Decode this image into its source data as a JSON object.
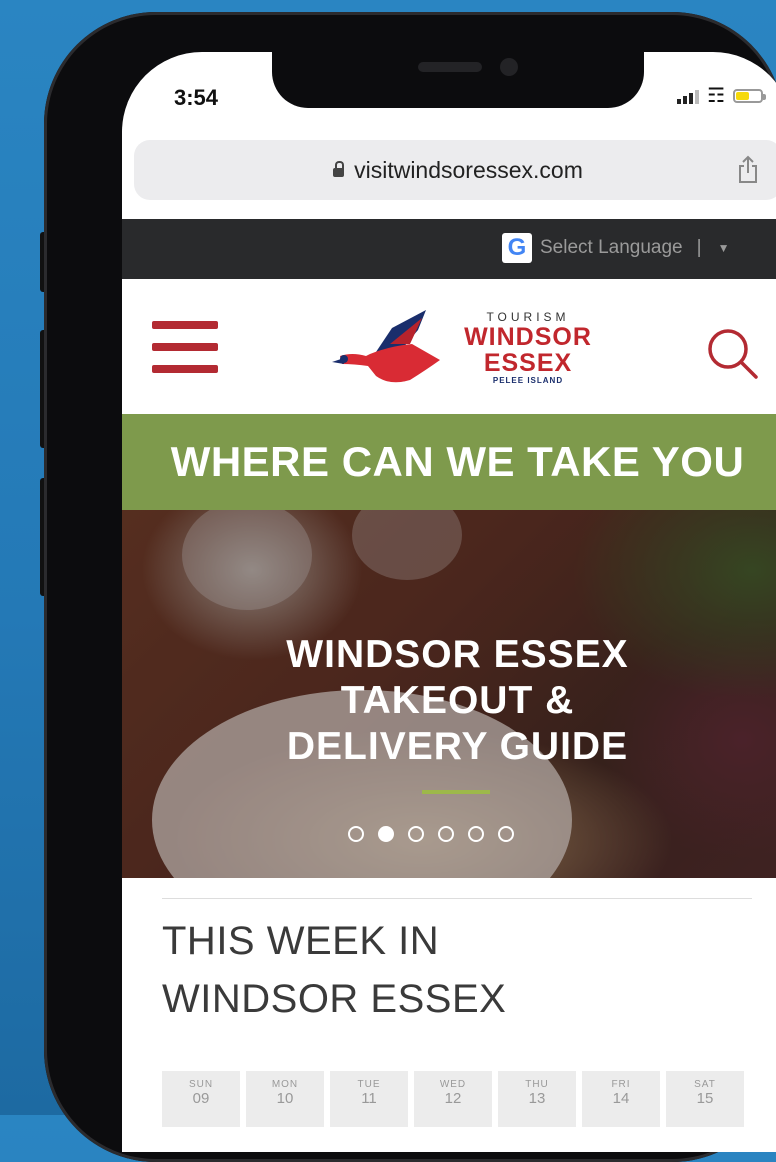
{
  "status_bar": {
    "time": "3:54"
  },
  "browser": {
    "url": "visitwindsoressex.com"
  },
  "language_bar": {
    "label": "Select Language",
    "separator": "|"
  },
  "logo": {
    "line1": "TOURISM",
    "line2": "WINDSOR",
    "line3": "ESSEX",
    "line4": "PELEE ISLAND"
  },
  "banner": {
    "text": "WHERE CAN WE TAKE YOU"
  },
  "hero": {
    "title_line1": "WINDSOR ESSEX",
    "title_line2": "TAKEOUT &",
    "title_line3": "DELIVERY GUIDE",
    "slide_count": 6,
    "active_slide": 2
  },
  "section": {
    "title_line1": "THIS WEEK IN",
    "title_line2": "WINDSOR ESSEX"
  },
  "week_days": [
    {
      "name": "SUN",
      "num": "09"
    },
    {
      "name": "MON",
      "num": "10"
    },
    {
      "name": "TUE",
      "num": "11"
    },
    {
      "name": "WED",
      "num": "12"
    },
    {
      "name": "THU",
      "num": "13"
    },
    {
      "name": "FRI",
      "num": "14"
    },
    {
      "name": "SAT",
      "num": "15"
    }
  ],
  "colors": {
    "brand_red": "#c1272d",
    "brand_navy": "#1a2e6c",
    "banner_green": "#7e9a4c",
    "background_blue": "#2479b6"
  },
  "icons": [
    "lock-icon",
    "share-icon",
    "google-translate-icon",
    "hamburger-menu-icon",
    "search-icon",
    "goose-logo-icon"
  ]
}
